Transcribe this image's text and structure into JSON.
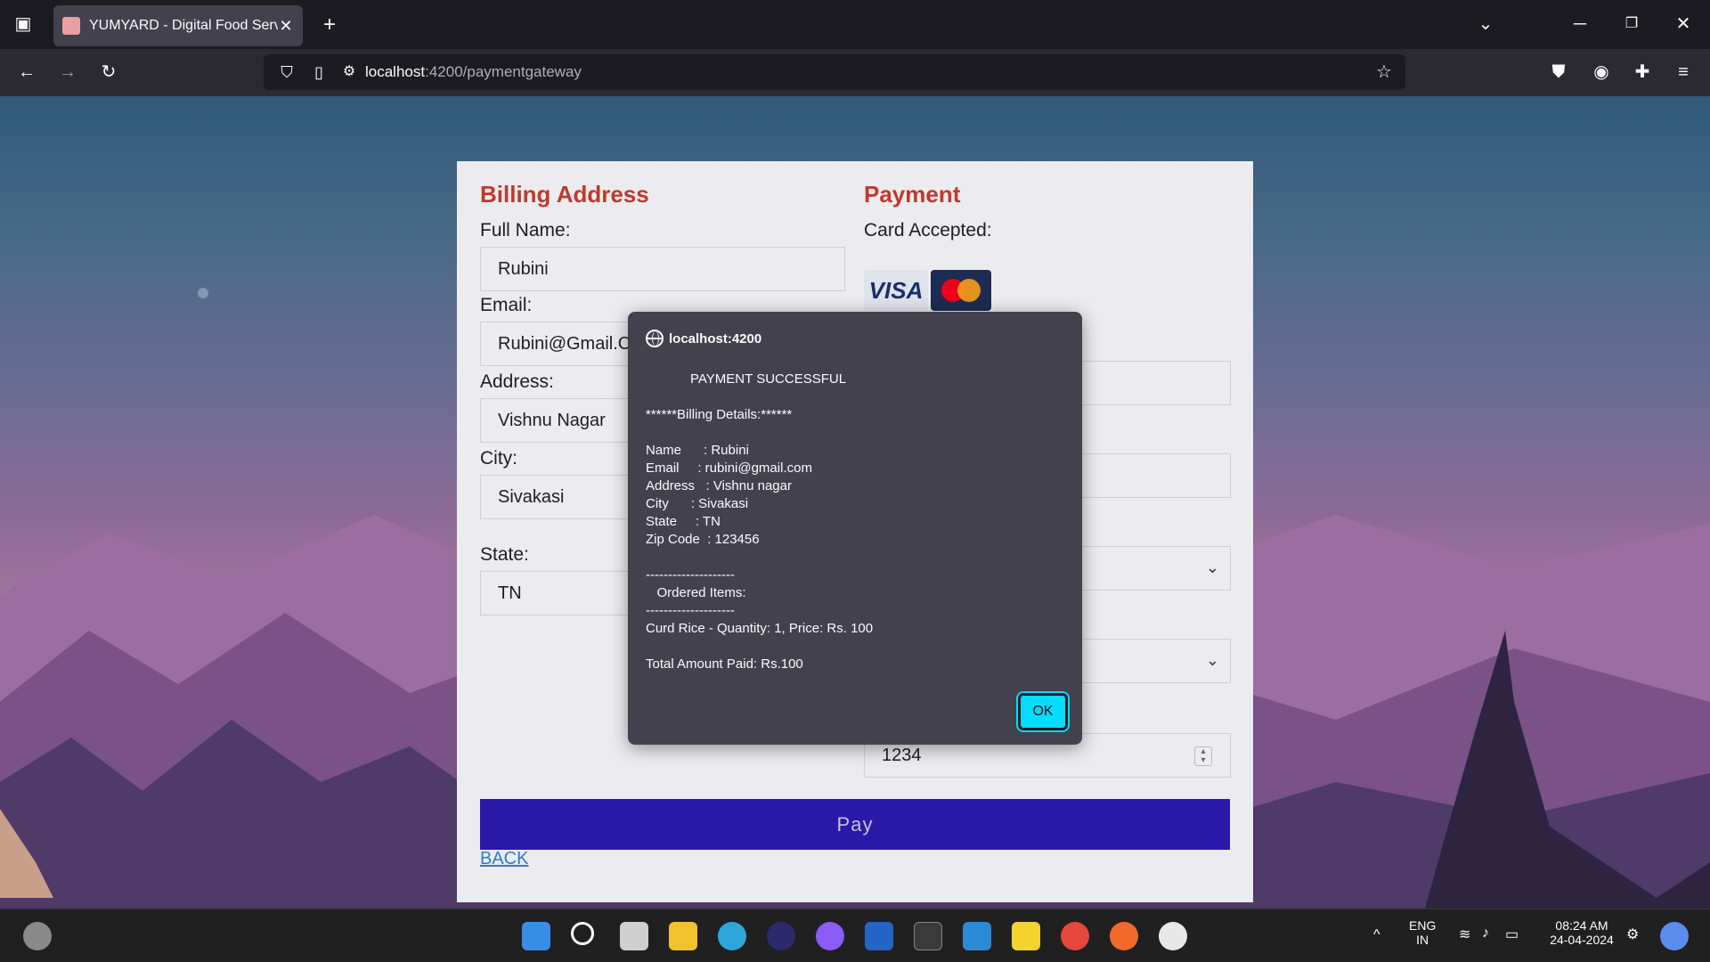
{
  "browser": {
    "tab_title": "YUMYARD - Digital Food Service",
    "url_host": "localhost",
    "url_path": ":4200/paymentgateway"
  },
  "billing": {
    "title": "Billing Address",
    "full_name_label": "Full Name:",
    "full_name_value": "Rubini",
    "email_label": "Email:",
    "email_value": "Rubini@Gmail.Com",
    "address_label": "Address:",
    "address_value": "Vishnu Nagar",
    "city_label": "City:",
    "city_value": "Sivakasi",
    "state_label": "State:",
    "state_value": "TN"
  },
  "payment": {
    "title": "Payment",
    "cards_label": "Card Accepted:",
    "visa_label": "VISA",
    "cvv_value": "1234"
  },
  "actions": {
    "pay_label": "Pay",
    "back_label": "BACK"
  },
  "dialog": {
    "origin": "localhost:4200",
    "lines": [
      "            PAYMENT SUCCESSFUL",
      "******Billing Details:******",
      "Name      : Rubini",
      "Email     : rubini@gmail.com",
      "Address   : Vishnu nagar",
      "City      : Sivakasi",
      "State     : TN",
      "Zip Code  : 123456",
      "--------------------",
      "   Ordered Items:",
      "--------------------",
      "Curd Rice - Quantity: 1, Price: Rs. 100",
      "Total Amount Paid: Rs.100"
    ],
    "ok_label": "OK"
  },
  "taskbar": {
    "lang": "ENG",
    "region": "IN",
    "time": "08:24 AM",
    "date": "24-04-2024"
  },
  "colors": {
    "accent_title": "#c0392b",
    "pay_button": "#2a19a8",
    "ok_button": "#00ddff"
  }
}
